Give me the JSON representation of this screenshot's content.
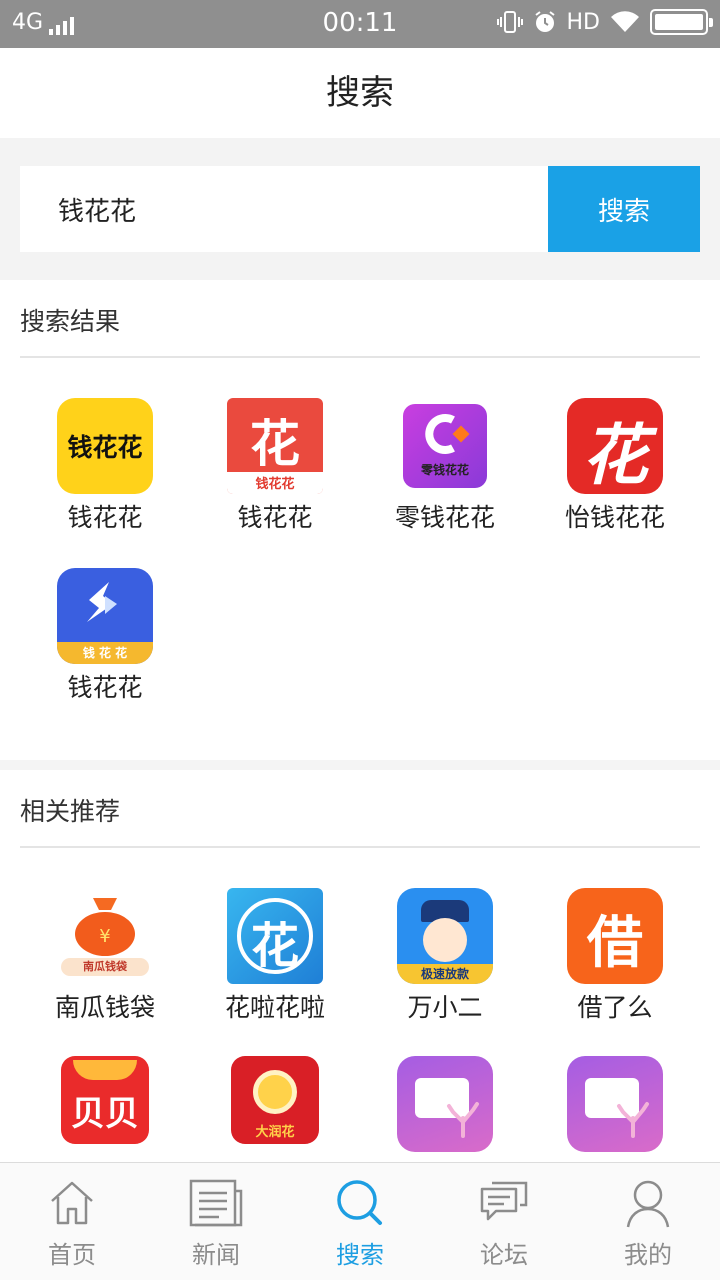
{
  "status_bar": {
    "network": "4G",
    "time": "00:11",
    "hd": "HD"
  },
  "header": {
    "title": "搜索"
  },
  "search": {
    "value": "钱花花",
    "button": "搜索"
  },
  "results": {
    "title": "搜索结果",
    "apps": [
      {
        "name": "钱花花",
        "icon_text": "钱花花"
      },
      {
        "name": "钱花花",
        "icon_text": "花",
        "icon_sub": "钱花花"
      },
      {
        "name": "零钱花花",
        "icon_sub": "零钱花花"
      },
      {
        "name": "怡钱花花",
        "icon_text": "花"
      },
      {
        "name": "钱花花",
        "icon_sub": "钱 花 花"
      }
    ]
  },
  "recommend": {
    "title": "相关推荐",
    "apps": [
      {
        "name": "南瓜钱袋",
        "icon_sub": "南瓜钱袋"
      },
      {
        "name": "花啦花啦",
        "icon_text": "花"
      },
      {
        "name": "万小二",
        "icon_sub": "极速放款"
      },
      {
        "name": "借了么",
        "icon_text": "借"
      },
      {
        "name": "",
        "icon_text": "贝贝"
      },
      {
        "name": "",
        "icon_sub": "大润花"
      },
      {
        "name": ""
      },
      {
        "name": ""
      }
    ]
  },
  "tabs": [
    {
      "label": "首页",
      "icon": "home-icon"
    },
    {
      "label": "新闻",
      "icon": "news-icon"
    },
    {
      "label": "搜索",
      "icon": "search-icon",
      "active": true
    },
    {
      "label": "论坛",
      "icon": "forum-icon"
    },
    {
      "label": "我的",
      "icon": "profile-icon"
    }
  ],
  "colors": {
    "accent": "#1aa1e6",
    "status_bar": "#8f8f8f"
  }
}
